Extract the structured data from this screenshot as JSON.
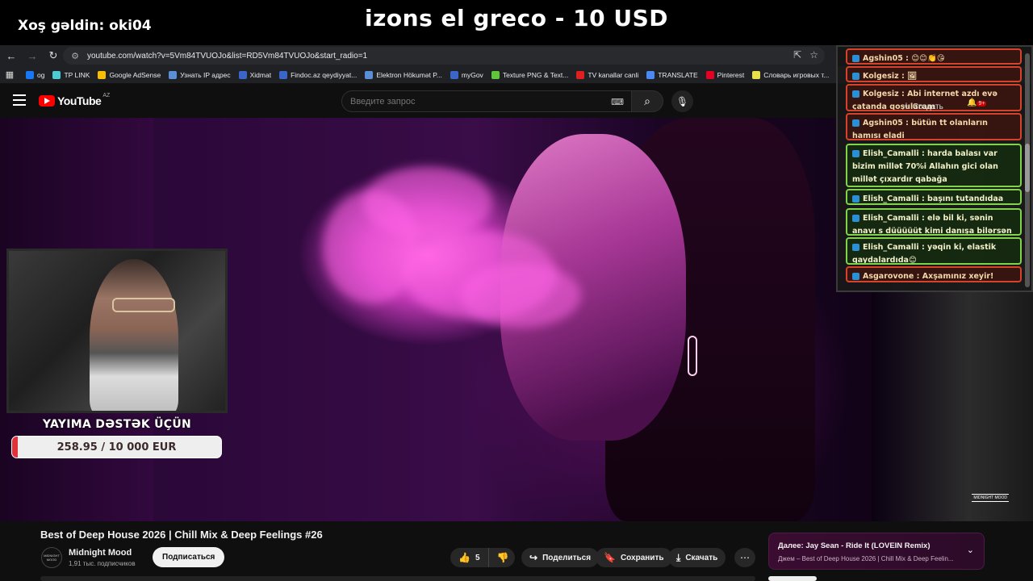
{
  "overlay": {
    "welcome": "Xoş gəldin: oki04",
    "donation_title": "izons el greco - 10 USD",
    "support_label": "YAYIMA DƏSTƏK ÜÇÜN",
    "goal_text": "258.95 / 10 000 EUR",
    "goal_progress": 0.026
  },
  "browser": {
    "url": "youtube.com/watch?v=5Vm84TVUOJo&list=RD5Vm84TVUOJo&start_radio=1",
    "bookmarks": [
      {
        "label": "og",
        "color": "#1877f2"
      },
      {
        "label": "TP LINK",
        "color": "#4acbd6"
      },
      {
        "label": "Google AdSense",
        "color": "#fbbc04"
      },
      {
        "label": "Узнать IP адрес",
        "color": "#5a8fd6"
      },
      {
        "label": "Xidmat",
        "color": "#3a66c7"
      },
      {
        "label": "Findoc.az qeydiyyat...",
        "color": "#3a66c7"
      },
      {
        "label": "Elektron Hökumət P...",
        "color": "#5a8fd6"
      },
      {
        "label": "myGov",
        "color": "#3a66c7"
      },
      {
        "label": "Texture PNG & Text...",
        "color": "#5fc73a"
      },
      {
        "label": "TV kanallar canli",
        "color": "#e02020"
      },
      {
        "label": "TRANSLATE",
        "color": "#4a8af4"
      },
      {
        "label": "Pinterest",
        "color": "#e60023"
      },
      {
        "label": "Словарь игровых т...",
        "color": "#e8e04a"
      }
    ]
  },
  "youtube": {
    "logo_text": "YouTube",
    "region": "AZ",
    "search_placeholder": "Введите запрос",
    "video_title": "Best of Deep House 2026 | Chill Mix & Deep Feelings #26",
    "channel_name": "Midnight Mood",
    "channel_subs": "1,91 тыс. подписчиков",
    "avatar_text": "MIDNIGHT MOOD",
    "subscribe_label": "Подписаться",
    "likes": "5",
    "share_label": "Поделиться",
    "save_label": "Сохранить",
    "download_label": "Скачать",
    "next_title": "Далее: Jay Sean - Ride It (LOVEIN Remix)",
    "next_sub": "Джем – Best of Deep House 2026 | Chill Mix & Deep Feelin...",
    "watermark": "MIDNIGHT MOOD"
  },
  "chat": {
    "messages": [
      {
        "text": "Agshin05 : 😊😊👏😘",
        "style": "red"
      },
      {
        "text": "Kolgesiz : 🖼",
        "style": "red"
      },
      {
        "text": "Kolgesiz : Abi internet azdı evə çatanda qoşularam",
        "style": "red"
      },
      {
        "text": "Agshin05 : bütün tt olanların hamısı eladi",
        "style": "red"
      },
      {
        "text": "Elish_Camalli : harda balası var bizim millət 70%i Allahın gici olan millət çıxardır qabağa",
        "style": "green"
      },
      {
        "text": "Elish_Camalli : başını tutandıdaa",
        "style": "green"
      },
      {
        "text": "Elish_Camalli : elə bil ki, sənin anavı s düüüüüt kimi danışa bilərsən mənnnccə",
        "style": "green"
      },
      {
        "text": "Elish_Camalli : yəqin ki, elastik qaydalardıda😊",
        "style": "green"
      },
      {
        "text": "Asgarovone : Axşamınız xeyir!",
        "style": "red"
      }
    ],
    "create_label": "Создать",
    "notif_count": "9+"
  },
  "colors": {
    "accent_red": "#e0313a",
    "yt_red": "#ff0000",
    "chat_red": "#d9422a",
    "chat_green": "#7fd44a"
  }
}
